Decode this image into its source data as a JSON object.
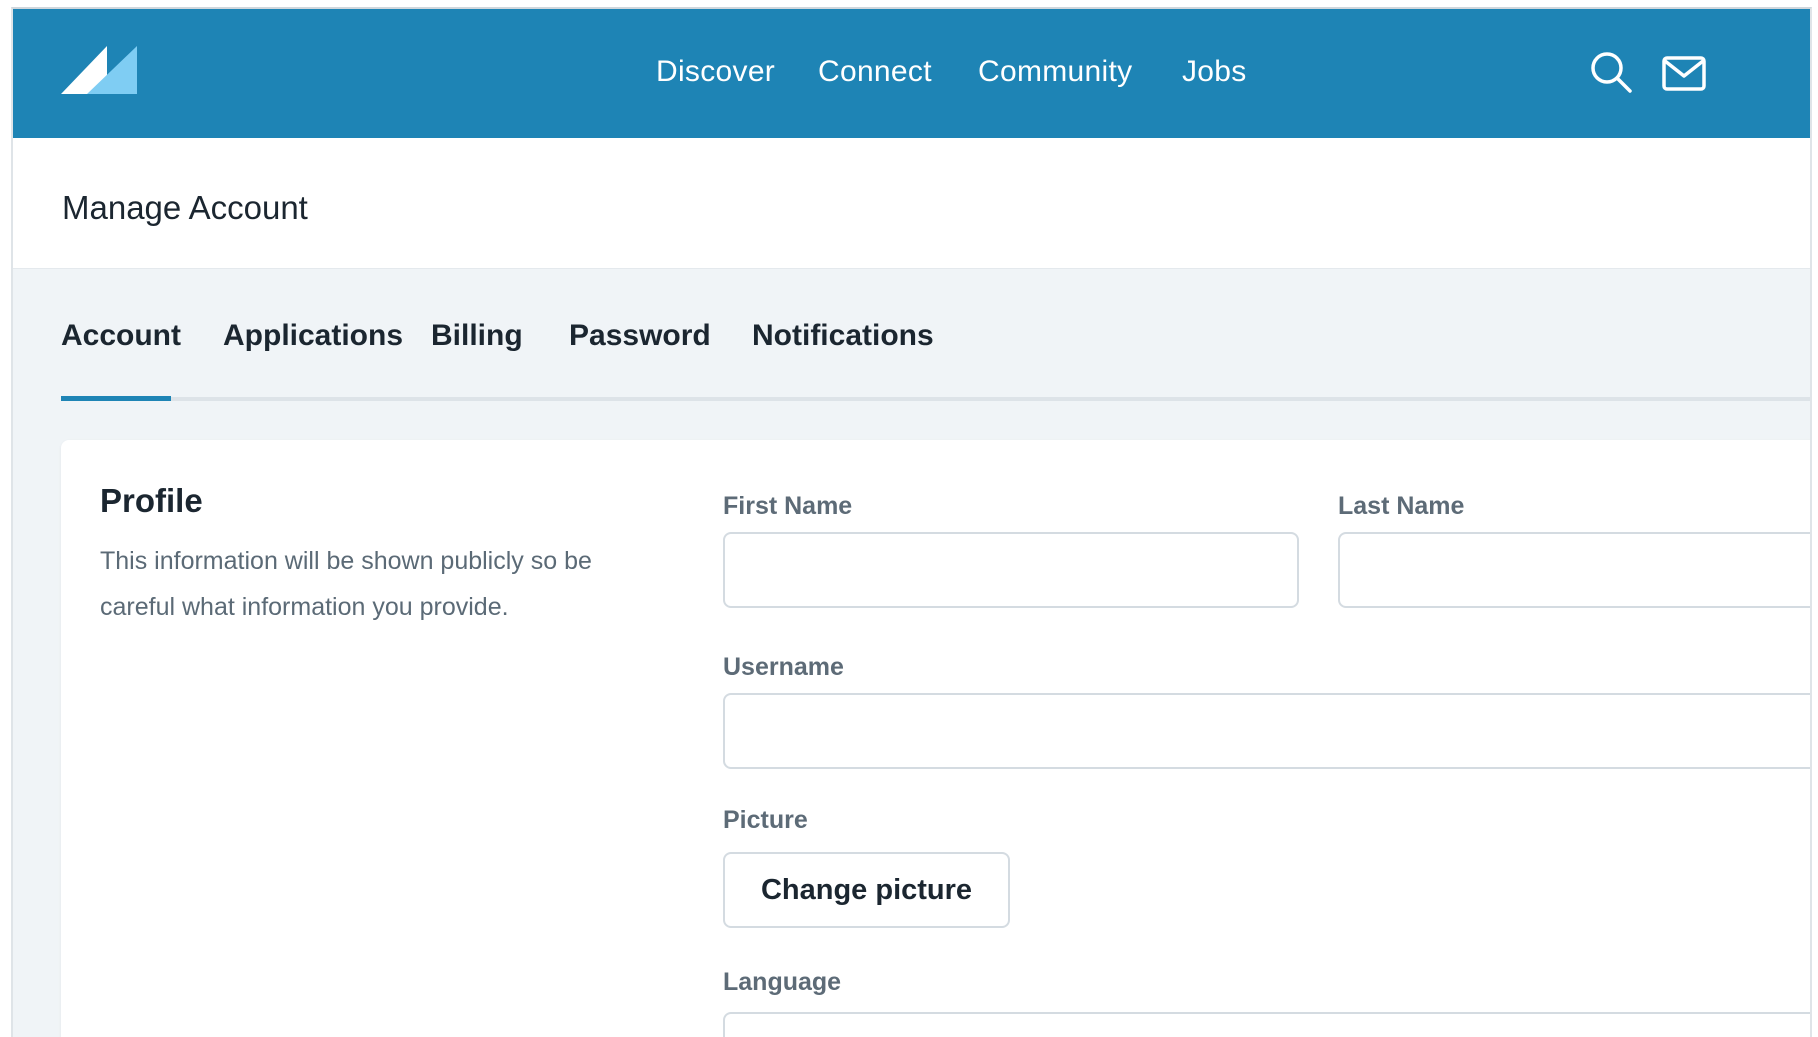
{
  "nav": {
    "logo_icon": "brand-logo-icon",
    "links": [
      {
        "label": "Discover"
      },
      {
        "label": "Connect"
      },
      {
        "label": "Community"
      },
      {
        "label": "Jobs"
      }
    ],
    "search_icon": "search-icon",
    "mail_icon": "mail-icon",
    "background_color": "#1e84b5"
  },
  "header": {
    "title": "Manage Account"
  },
  "tabs": {
    "items": [
      {
        "label": "Account"
      },
      {
        "label": "Applications"
      },
      {
        "label": "Billing"
      },
      {
        "label": "Password"
      },
      {
        "label": "Notifications"
      }
    ],
    "active": "Account",
    "accent_color": "#1e84b5"
  },
  "profile": {
    "title": "Profile",
    "description": "This information will be shown publicly so be careful what information you provide.",
    "fields": {
      "first_name": {
        "label": "First Name",
        "value": "",
        "placeholder": ""
      },
      "last_name": {
        "label": "Last Name",
        "value": "",
        "placeholder": ""
      },
      "username": {
        "label": "Username",
        "value": "",
        "placeholder": ""
      },
      "picture": {
        "label": "Picture",
        "button_label": "Change picture"
      },
      "language": {
        "label": "Language",
        "value": ""
      }
    }
  }
}
